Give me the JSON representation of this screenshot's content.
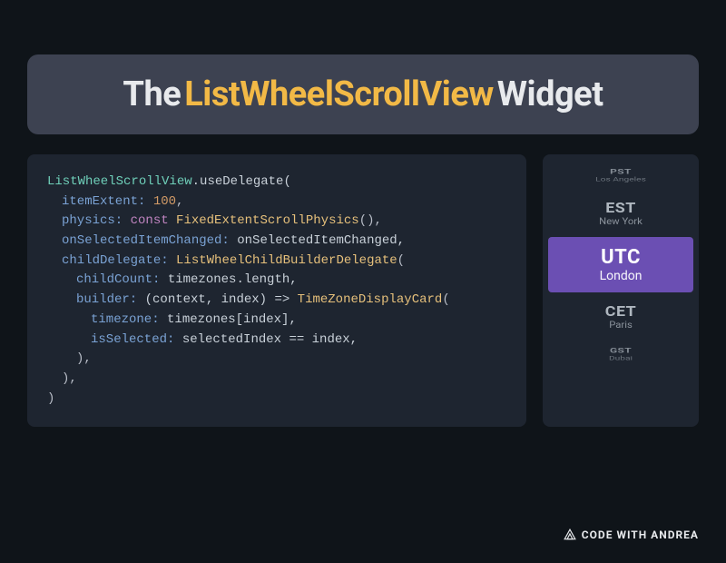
{
  "title": {
    "word1": "The",
    "word2": "ListWheelScrollView",
    "word3": "Widget"
  },
  "code": {
    "l1_type": "ListWheelScrollView",
    "l1_method": ".useDelegate(",
    "l2_param": "itemExtent:",
    "l2_val": "100",
    "l2_comma": ",",
    "l3_param": "physics:",
    "l3_kw": "const",
    "l3_class": "FixedExtentScrollPhysics",
    "l3_rest": "(),",
    "l4_param": "onSelectedItemChanged:",
    "l4_val": "onSelectedItemChanged,",
    "l5_param": "childDelegate:",
    "l5_class": "ListWheelChildBuilderDelegate",
    "l5_open": "(",
    "l6_param": "childCount:",
    "l6_val": "timezones.length,",
    "l7_param": "builder:",
    "l7_arrow": "(context, index) =>",
    "l7_class": "TimeZoneDisplayCard",
    "l7_open": "(",
    "l8_param": "timezone:",
    "l8_val": "timezones[index],",
    "l9_param": "isSelected:",
    "l9_val": "selectedIndex == index,",
    "l10": "),",
    "l11": "),",
    "l12": ")"
  },
  "wheel": {
    "items": [
      {
        "abbr": "PST",
        "city": "Los Angeles"
      },
      {
        "abbr": "EST",
        "city": "New York"
      },
      {
        "abbr": "UTC",
        "city": "London"
      },
      {
        "abbr": "CET",
        "city": "Paris"
      },
      {
        "abbr": "GST",
        "city": "Dubai"
      }
    ],
    "selectedIndex": 2
  },
  "footer": {
    "brand": "CODE WITH ANDREA"
  }
}
